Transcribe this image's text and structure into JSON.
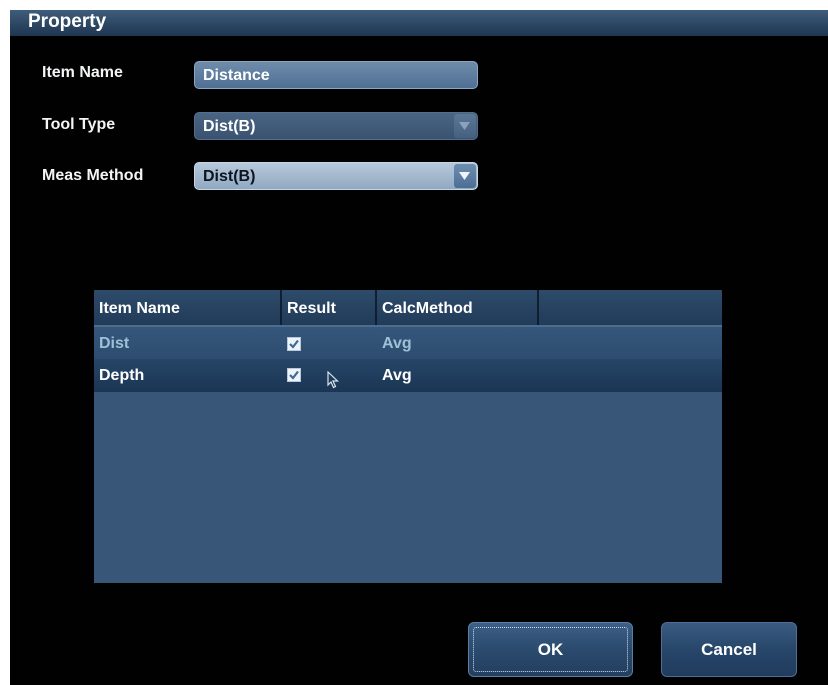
{
  "dialog": {
    "title": "Property"
  },
  "form": {
    "item_name_label": "Item Name",
    "item_name_value": "Distance",
    "tool_type_label": "Tool Type",
    "tool_type_value": "Dist(B)",
    "meas_method_label": "Meas Method",
    "meas_method_value": "Dist(B)"
  },
  "table": {
    "headers": [
      "Item Name",
      "Result",
      "CalcMethod",
      ""
    ],
    "rows": [
      {
        "item_name": "Dist",
        "result_checked": true,
        "calc_method": "Avg",
        "state": "normal"
      },
      {
        "item_name": "Depth",
        "result_checked": true,
        "calc_method": "Avg",
        "state": "selected"
      }
    ]
  },
  "buttons": {
    "ok_label": "OK",
    "cancel_label": "Cancel"
  },
  "icons": {
    "dropdown": "chevron-down-icon",
    "checkbox": "checkbox-checked-icon",
    "cursor": "mouse-pointer-icon"
  },
  "colors": {
    "background": "#010101",
    "title_bar": "#2c4763",
    "table_body": "#385678",
    "selected_row": "#1f3a5a",
    "dim_text": "#9fc0d6"
  }
}
